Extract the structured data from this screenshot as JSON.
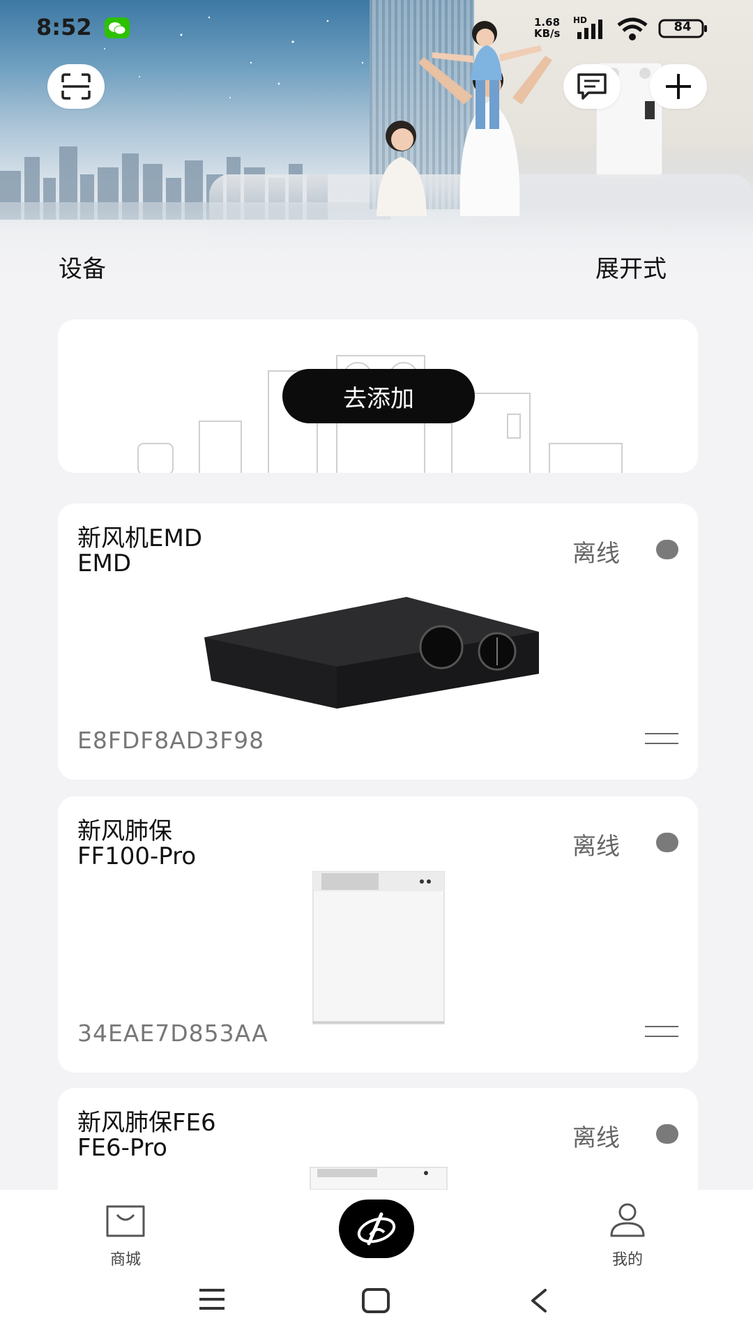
{
  "status_bar": {
    "time": "8:52",
    "net_speed_value": "1.68",
    "net_speed_unit": "KB/s",
    "hd_label": "HD",
    "battery": "84"
  },
  "header": {
    "section_title": "设备",
    "expand_label": "展开式",
    "icons": [
      "scan-icon",
      "message-icon",
      "plus-icon"
    ]
  },
  "add_card": {
    "button_label": "去添加"
  },
  "devices": [
    {
      "name": "新风机EMD",
      "model": "EMD",
      "status": "离线",
      "device_id": "E8FDF8AD3F98"
    },
    {
      "name": "新风肺保",
      "model": "FF100-Pro",
      "status": "离线",
      "device_id": "34EAE7D853AA"
    },
    {
      "name": "新风肺保FE6",
      "model": "FE6-Pro",
      "status": "离线"
    }
  ],
  "bottom_nav": {
    "shop_label": "商城",
    "mine_label": "我的"
  },
  "colors": {
    "accent": "#0c0c0c",
    "offline_dot": "#7a7a7a",
    "background": "#f3f3f5"
  }
}
